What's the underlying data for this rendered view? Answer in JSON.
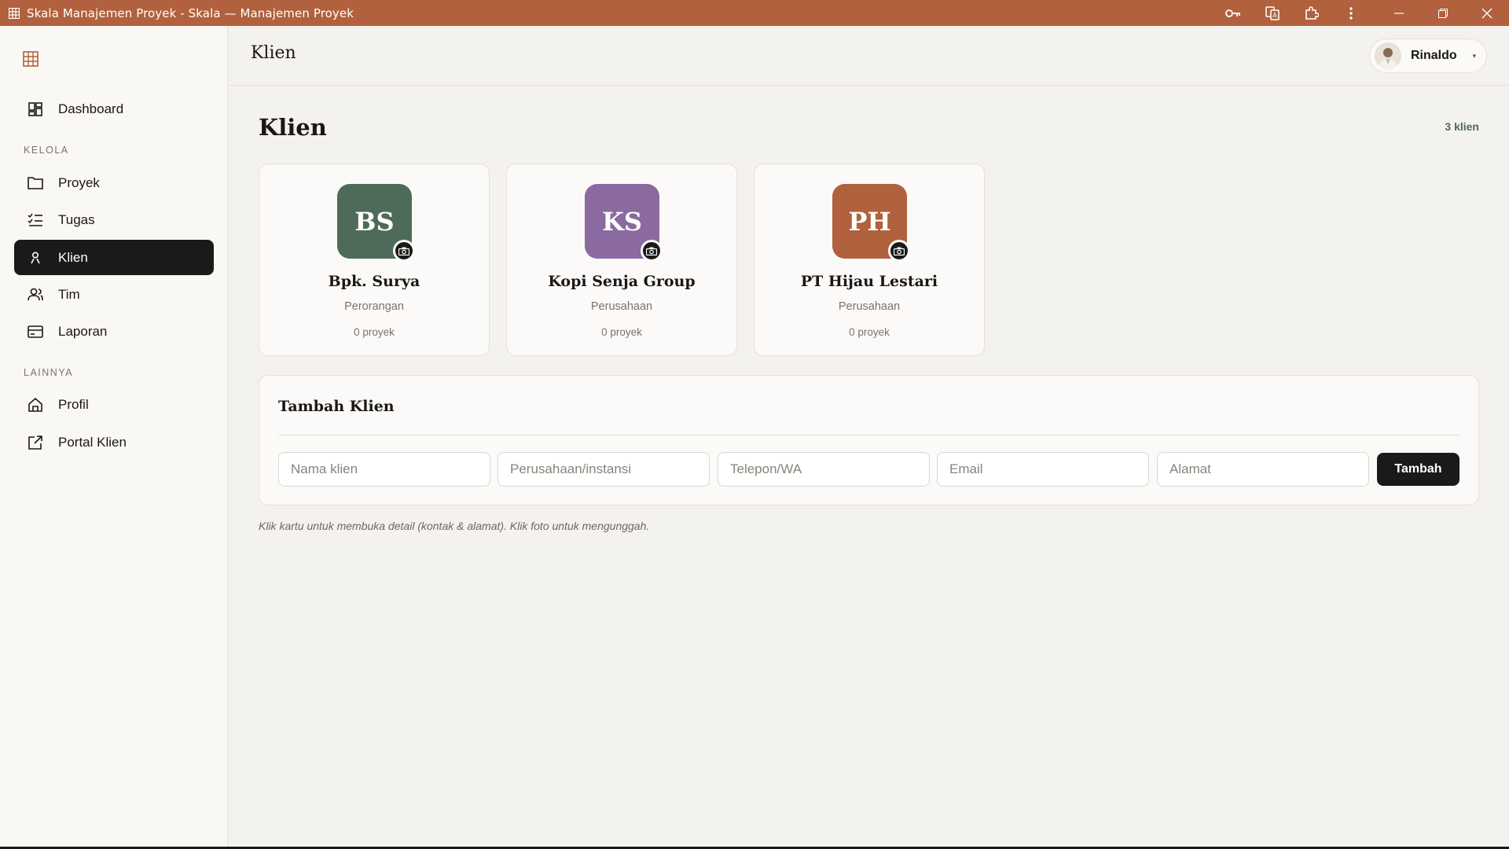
{
  "window": {
    "title": "Skala Manajemen Proyek - Skala — Manajemen Proyek",
    "title_bar_color": "#b1613d"
  },
  "sidebar": {
    "items": [
      {
        "label": "Dashboard",
        "icon": "dashboard-icon"
      },
      {
        "label": "Proyek",
        "icon": "folder-icon"
      },
      {
        "label": "Tugas",
        "icon": "tasks-list-icon"
      },
      {
        "label": "Klien",
        "icon": "person-icon",
        "active": true
      },
      {
        "label": "Tim",
        "icon": "team-icon"
      },
      {
        "label": "Laporan",
        "icon": "card-icon"
      },
      {
        "label": "Profil",
        "icon": "home-icon"
      },
      {
        "label": "Portal Klien",
        "icon": "external-link-icon"
      }
    ],
    "sections": {
      "manage": "KELOLA",
      "other": "LAINNYA"
    }
  },
  "header": {
    "title": "Klien",
    "user": {
      "name": "Rinaldo"
    }
  },
  "main": {
    "title": "Klien",
    "count": "3 klien",
    "clients": [
      {
        "initials": "BS",
        "name": "Bpk. Surya",
        "type": "Perorangan",
        "projects": "0 proyek",
        "color": "#4d6b58"
      },
      {
        "initials": "KS",
        "name": "Kopi Senja Group",
        "type": "Perusahaan",
        "projects": "0 proyek",
        "color": "#8a6aa0"
      },
      {
        "initials": "PH",
        "name": "PT Hijau Lestari",
        "type": "Perusahaan",
        "projects": "0 proyek",
        "color": "#b1613d"
      }
    ],
    "form": {
      "title": "Tambah Klien",
      "placeholders": {
        "name": "Nama klien",
        "company": "Perusahaan/instansi",
        "phone": "Telepon/WA",
        "email": "Email",
        "address": "Alamat"
      },
      "submit_label": "Tambah"
    },
    "hint": "Klik kartu untuk membuka detail (kontak & alamat). Klik foto untuk mengunggah."
  }
}
